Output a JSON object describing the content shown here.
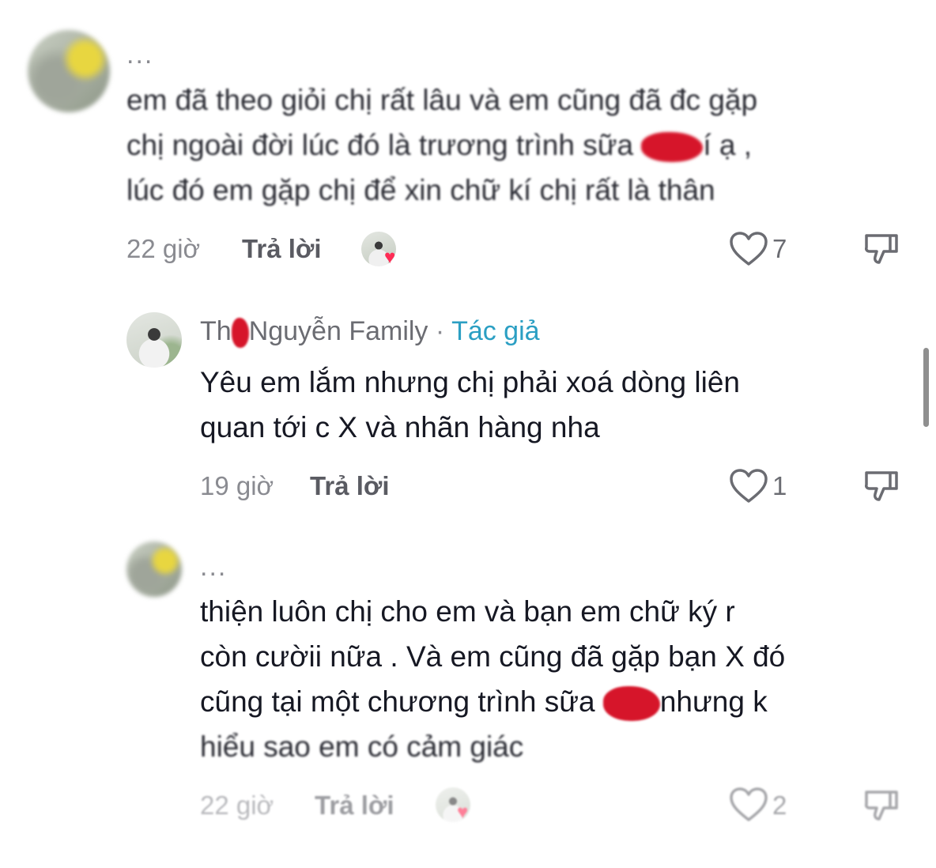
{
  "comments": [
    {
      "username": "...",
      "text_lines": [
        "em đã theo giỏi chị rất lâu và em cũng đã đc gặp",
        "chị ngoài đời lúc đó là trương trình sữa ",
        "lúc đó em gặp chị để xin chữ kí chị rất là thân"
      ],
      "text_line2_tail": "í ạ ,",
      "time": "22 giờ",
      "reply_label": "Trả lời",
      "likes": "7"
    },
    {
      "username_prefix": "Th",
      "username_suffix": "Nguyễn Family",
      "separator": "·",
      "author_badge": "Tác giả",
      "text_lines": [
        "Yêu em lắm nhưng chị phải xoá dòng liên",
        "quan tới c X và nhãn hàng nha"
      ],
      "time": "19 giờ",
      "reply_label": "Trả lời",
      "likes": "1"
    },
    {
      "username": "...",
      "text_lines": [
        "thiện luôn chị cho em và bạn em chữ ký r",
        "còn cườii nữa . Và em cũng đã gặp bạn X đó",
        "cũng tại một chương trình sữa ",
        "hiểu sao em có cảm giác"
      ],
      "text_line3_tail": "nhưng k",
      "time": "22 giờ",
      "reply_label": "Trả lời",
      "likes": "2"
    }
  ],
  "icons": {
    "heart": "heart-outline-icon",
    "dislike": "thumbs-down-icon",
    "liker_heart": "heart-filled-icon"
  },
  "colors": {
    "author_badge": "#2b9fc3",
    "like_heart": "#fe2c55",
    "redaction": "#d6152a"
  }
}
